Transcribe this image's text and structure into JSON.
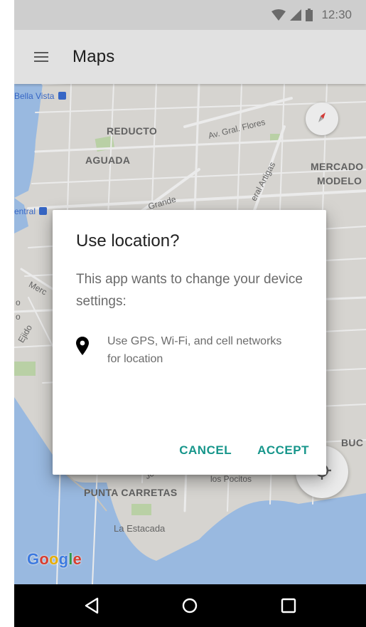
{
  "status_bar": {
    "time": "12:30",
    "icons": [
      "wifi-icon",
      "cell-signal-icon",
      "battery-icon"
    ]
  },
  "app_bar": {
    "title": "Maps",
    "menu_icon": "hamburger-menu-icon"
  },
  "map": {
    "transit_labels": [
      "Bella Vista",
      "entral"
    ],
    "district_labels": {
      "reducto": "REDUCTO",
      "aguada": "AGUADA",
      "mercado": "MERCADO",
      "modelo": "MODELO",
      "punta_carretas": "PUNTA CARRETAS",
      "buc": "BUC"
    },
    "street_labels": {
      "flores": "Av. Gral. Flores",
      "grande": "Grande",
      "artigas": "eral Artigas",
      "merc": "Merc",
      "ejido": "Ejido",
      "o1": "o",
      "o2": "o",
      "pocitos": "los Pocitos",
      "jo": "Jo",
      "estacada": "La Estacada"
    },
    "google_logo": [
      "G",
      "o",
      "o",
      "g",
      "l",
      "e"
    ],
    "colors": {
      "land": "#e9e7e2",
      "water": "#a6c9f4",
      "roads": "#ffffff",
      "parks": "#c9e2b3"
    }
  },
  "dialog": {
    "title": "Use location?",
    "message": "This app wants to change your device settings:",
    "item_icon": "location-pin-icon",
    "item_text": "Use GPS, Wi-Fi, and cell networks for location",
    "cancel_label": "CANCEL",
    "accept_label": "ACCEPT",
    "accent_color": "#17968b"
  },
  "nav_bar": {
    "icons": [
      "back-icon",
      "home-icon",
      "recents-icon"
    ]
  }
}
